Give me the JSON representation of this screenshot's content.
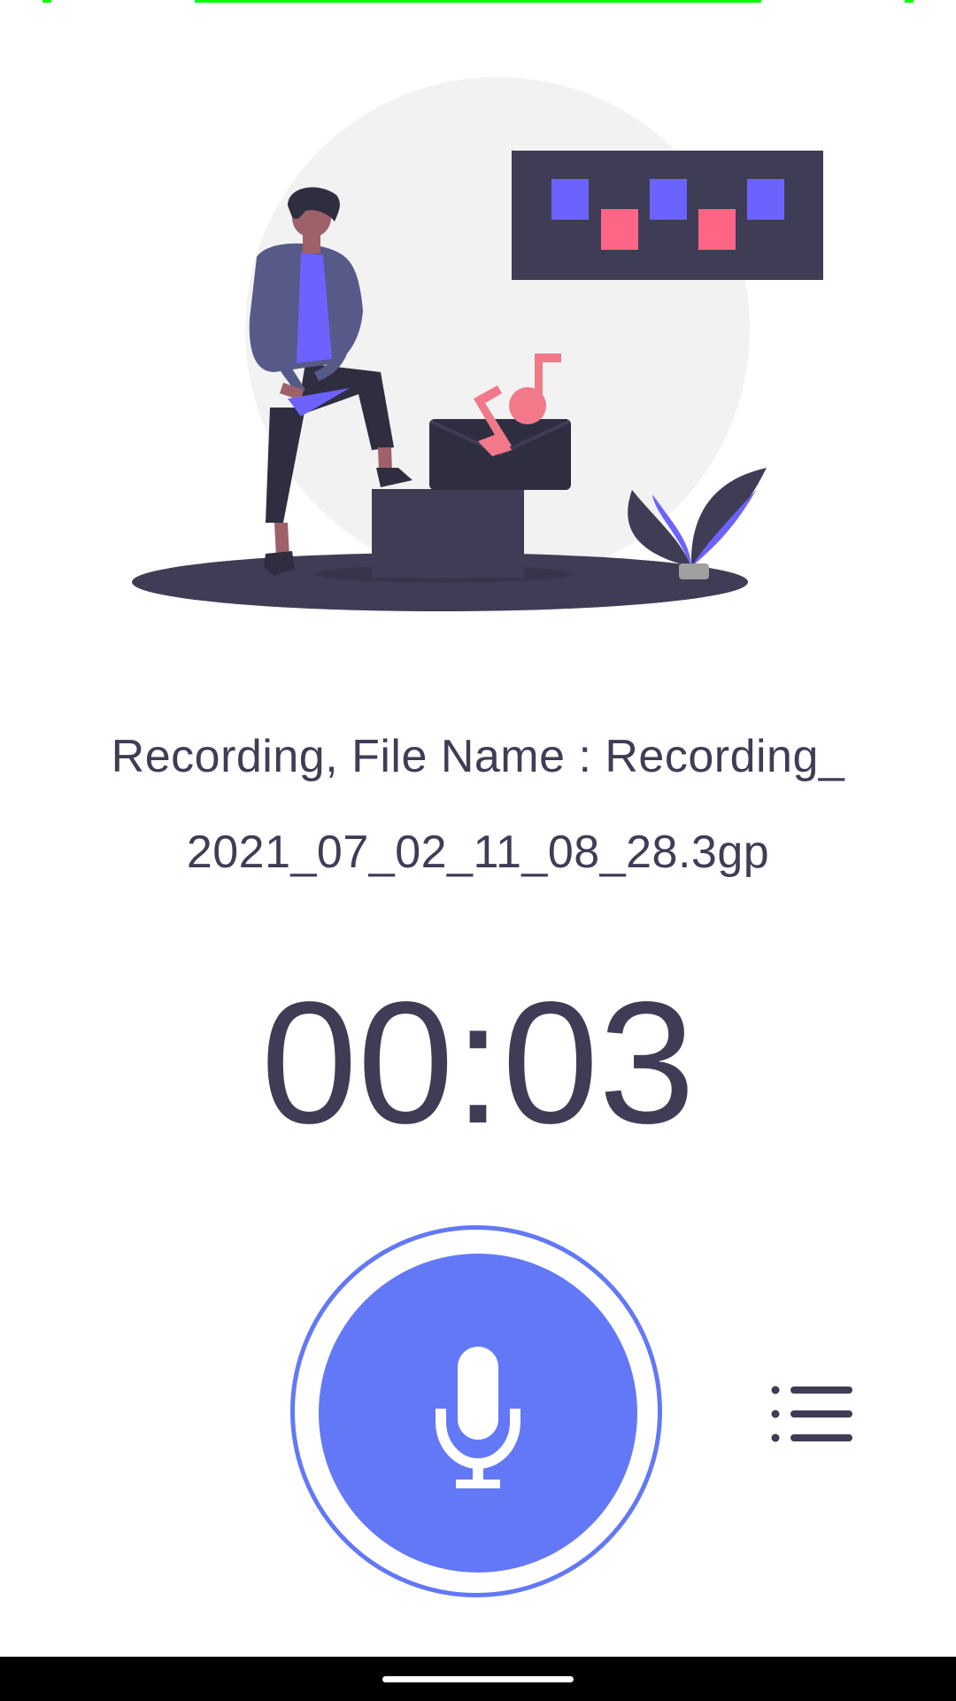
{
  "recording": {
    "file_name_line1": "Recording, File Name : Recording_",
    "file_name_line2": "2021_07_02_11_08_28.3gp",
    "elapsed": "00:03"
  },
  "controls": {
    "record_icon": "microphone-icon",
    "list_icon": "list-icon"
  },
  "colors": {
    "accent": "#6378f7",
    "text": "#3f3d56",
    "illustration_dark": "#3f3d56",
    "illustration_purple": "#6c63ff",
    "illustration_pink": "#ff6584",
    "status_strip": "#00ff00"
  }
}
